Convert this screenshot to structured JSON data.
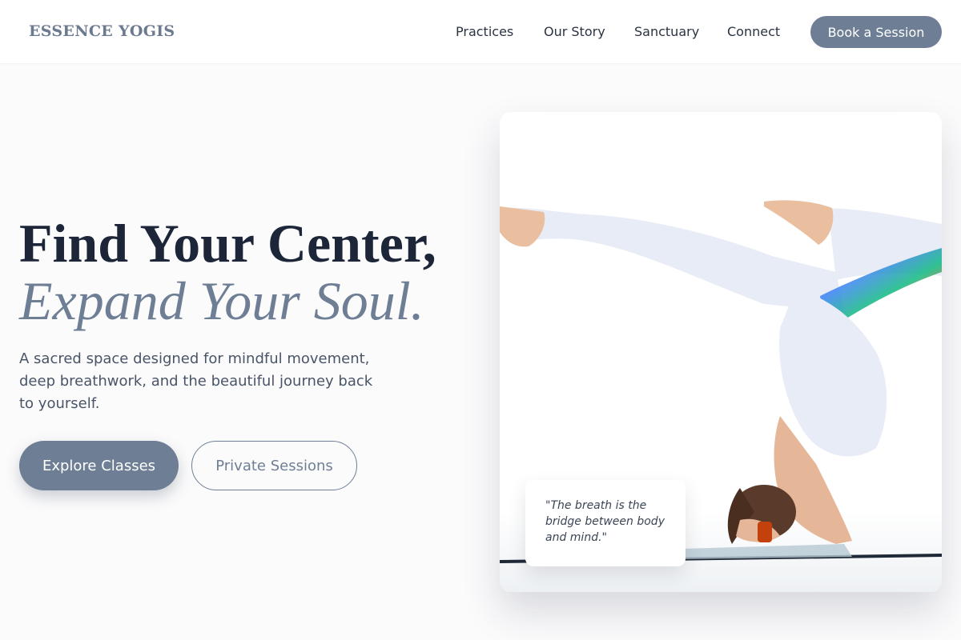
{
  "header": {
    "brand": "ESSENCE YOGIS",
    "nav": {
      "practices": "Practices",
      "story": "Our Story",
      "sanctuary": "Sanctuary",
      "connect": "Connect"
    },
    "cta": "Book a Session"
  },
  "hero": {
    "title_line1": "Find Your Center,",
    "title_line2": "Expand Your Soul.",
    "subtitle": "A sacred space designed for mindful movement, deep breathwork, and the beautiful journey back to yourself.",
    "primary_button": "Explore Classes",
    "secondary_button": "Private Sessions"
  },
  "image": {
    "quote": "\"The breath is the bridge between body and mind.\""
  },
  "colors": {
    "accent": "#6e7f95",
    "heading": "#1c2638",
    "background": "#fbfbfc"
  },
  "icons": {
    "hero_photo": "yoga-headstand-photo"
  }
}
